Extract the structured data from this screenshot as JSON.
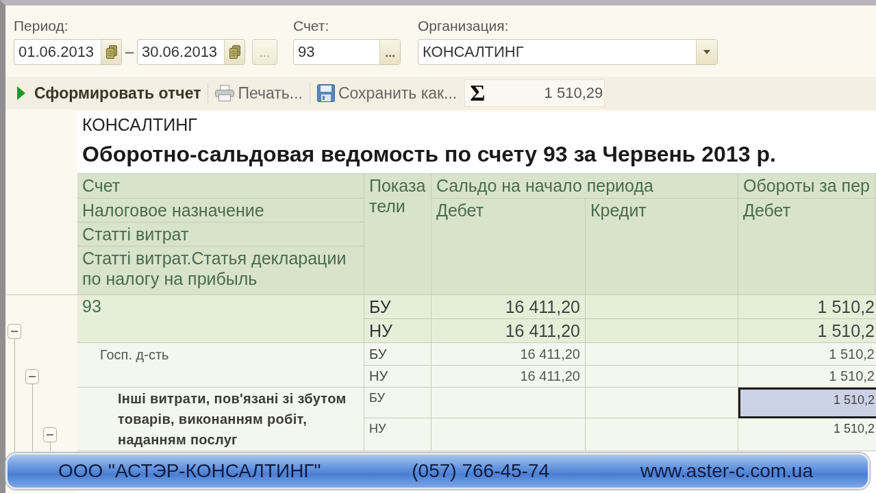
{
  "filters": {
    "period": {
      "label": "Период:",
      "from": "01.06.2013",
      "separator": "–",
      "to": "30.06.2013",
      "button": "..."
    },
    "account": {
      "label": "Счет:",
      "value": "93",
      "button": "..."
    },
    "organization": {
      "label": "Организация:",
      "value": "КОНСАЛТИНГ"
    }
  },
  "toolbar": {
    "buttons": [
      {
        "kind": "generate",
        "label": "Сформировать отчет"
      },
      {
        "kind": "print",
        "label": "Печать..."
      },
      {
        "kind": "save",
        "label": "Сохранить как..."
      }
    ],
    "sum": {
      "symbol": "Σ",
      "value": "1 510,29"
    }
  },
  "report": {
    "organization": "КОНСАЛТИНГ",
    "title": "Оборотно-сальдовая ведомость по счету 93 за Червень 2013 р.",
    "header": {
      "row_fields": [
        "Счет",
        "Налоговое назначение",
        "Статті витрат",
        "Статті витрат.Статья декларации по налогу на прибыль"
      ],
      "indicator": "Показатели",
      "groups": [
        {
          "label": "Сальдо на начало периода",
          "columns": [
            "Дебет",
            "Кредит"
          ]
        },
        {
          "label": "Обороты за пер",
          "columns": [
            "Дебет"
          ]
        }
      ]
    },
    "rows": [
      {
        "label": "93",
        "expanded": true,
        "indicators": [
          {
            "name": "БУ",
            "cells": [
              {
                "value": "16 411,20",
                "selected": false
              },
              {
                "selected": false
              },
              {
                "value": "1 510,2",
                "selected": false
              }
            ]
          },
          {
            "name": "НУ",
            "cells": [
              {
                "value": "16 411,20",
                "selected": false
              },
              {
                "selected": false
              },
              {
                "value": "1 510,2",
                "selected": false
              }
            ]
          }
        ],
        "children": [
          {
            "label": "Госп. д-сть",
            "expanded": true,
            "indicators": [
              {
                "name": "БУ",
                "cells": [
                  {
                    "value": "16 411,20",
                    "selected": false
                  },
                  {
                    "selected": false
                  },
                  {
                    "value": "1 510,2",
                    "selected": false
                  }
                ]
              },
              {
                "name": "НУ",
                "cells": [
                  {
                    "value": "16 411,20",
                    "selected": false
                  },
                  {
                    "selected": false
                  },
                  {
                    "value": "1 510,2",
                    "selected": false
                  }
                ]
              }
            ],
            "children": [
              {
                "label": "Інші витрати, пов'язані зі збутом товарів, виконанням робіт, наданням послуг",
                "expanded": true,
                "indicators": [
                  {
                    "name": "БУ",
                    "cells": [
                      {
                        "selected": false
                      },
                      {
                        "selected": false
                      },
                      {
                        "value": "1 510,2",
                        "selected": true
                      }
                    ]
                  },
                  {
                    "name": "НУ",
                    "cells": [
                      {
                        "selected": false
                      },
                      {
                        "selected": false
                      },
                      {
                        "value": "1 510,2",
                        "selected": false
                      }
                    ]
                  }
                ]
              }
            ]
          }
        ]
      }
    ]
  },
  "banner": {
    "company": "ООО \"АСТЭР-КОНСАЛТИНГ\"",
    "phone": "(057) 766-45-74",
    "website": "www.aster-c.com.ua"
  }
}
